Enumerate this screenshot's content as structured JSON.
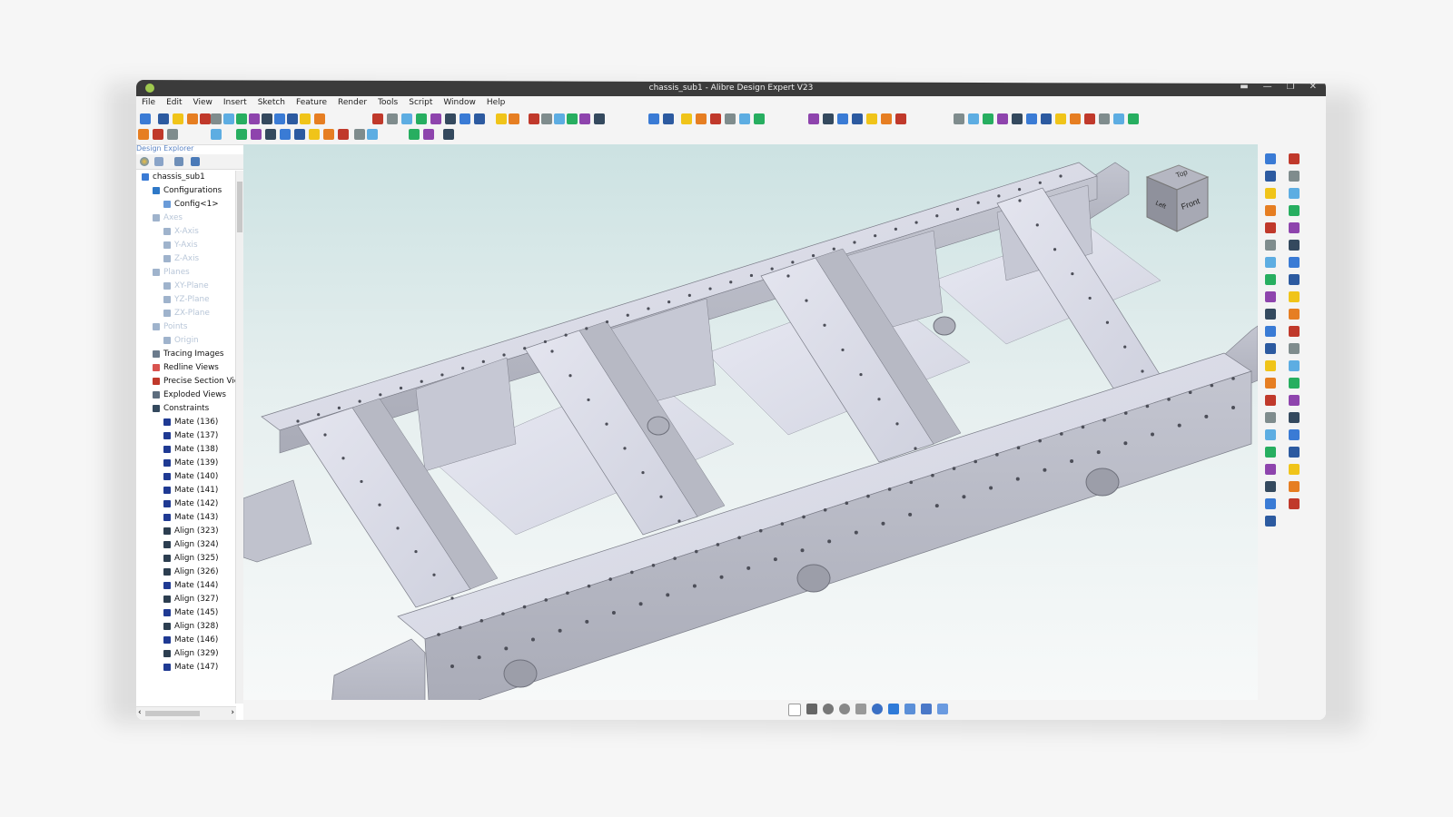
{
  "window": {
    "title": "chassis_sub1 - Alibre Design Expert V23"
  },
  "menu": [
    "File",
    "Edit",
    "View",
    "Insert",
    "Sketch",
    "Feature",
    "Render",
    "Tools",
    "Script",
    "Window",
    "Help"
  ],
  "explorer": {
    "label": "Design Explorer",
    "tree": [
      {
        "label": "chassis_sub1",
        "indent": 0,
        "dim": false,
        "icon": "assembly-icon",
        "color": "#3a7bd5"
      },
      {
        "label": "Configurations",
        "indent": 1,
        "dim": false,
        "icon": "configurations-icon",
        "color": "#2e78c7"
      },
      {
        "label": "Config<1>",
        "indent": 2,
        "dim": false,
        "icon": "config-icon",
        "color": "#6a9bd8"
      },
      {
        "label": "Axes",
        "indent": 1,
        "dim": true,
        "icon": "axes-icon",
        "color": "#9fb3cc"
      },
      {
        "label": "X-Axis",
        "indent": 2,
        "dim": true,
        "icon": "axis-icon",
        "color": "#9fb3cc"
      },
      {
        "label": "Y-Axis",
        "indent": 2,
        "dim": true,
        "icon": "axis-icon",
        "color": "#9fb3cc"
      },
      {
        "label": "Z-Axis",
        "indent": 2,
        "dim": true,
        "icon": "axis-icon",
        "color": "#9fb3cc"
      },
      {
        "label": "Planes",
        "indent": 1,
        "dim": true,
        "icon": "planes-icon",
        "color": "#9fb3cc"
      },
      {
        "label": "XY-Plane",
        "indent": 2,
        "dim": true,
        "icon": "plane-icon",
        "color": "#9fb3cc"
      },
      {
        "label": "YZ-Plane",
        "indent": 2,
        "dim": true,
        "icon": "plane-icon",
        "color": "#9fb3cc"
      },
      {
        "label": "ZX-Plane",
        "indent": 2,
        "dim": true,
        "icon": "plane-icon",
        "color": "#9fb3cc"
      },
      {
        "label": "Points",
        "indent": 1,
        "dim": true,
        "icon": "points-icon",
        "color": "#9fb3cc"
      },
      {
        "label": "Origin",
        "indent": 2,
        "dim": true,
        "icon": "origin-icon",
        "color": "#9fb3cc"
      },
      {
        "label": "Tracing Images",
        "indent": 1,
        "dim": false,
        "icon": "image-icon",
        "color": "#6b7b8c"
      },
      {
        "label": "Redline Views",
        "indent": 1,
        "dim": false,
        "icon": "redline-icon",
        "color": "#d9534f"
      },
      {
        "label": "Precise Section View",
        "indent": 1,
        "dim": false,
        "icon": "section-icon",
        "color": "#c0392b"
      },
      {
        "label": "Exploded Views",
        "indent": 1,
        "dim": false,
        "icon": "exploded-icon",
        "color": "#5d6d7e"
      },
      {
        "label": "Constraints",
        "indent": 1,
        "dim": false,
        "icon": "constraints-icon",
        "color": "#34495e"
      },
      {
        "label": "Mate (136)",
        "indent": 2,
        "dim": false,
        "icon": "mate-icon",
        "color": "#1f3a93"
      },
      {
        "label": "Mate (137)",
        "indent": 2,
        "dim": false,
        "icon": "mate-icon",
        "color": "#1f3a93"
      },
      {
        "label": "Mate (138)",
        "indent": 2,
        "dim": false,
        "icon": "mate-icon",
        "color": "#1f3a93"
      },
      {
        "label": "Mate (139)",
        "indent": 2,
        "dim": false,
        "icon": "mate-icon",
        "color": "#1f3a93"
      },
      {
        "label": "Mate (140)",
        "indent": 2,
        "dim": false,
        "icon": "mate-icon",
        "color": "#1f3a93"
      },
      {
        "label": "Mate (141)",
        "indent": 2,
        "dim": false,
        "icon": "mate-icon",
        "color": "#1f3a93"
      },
      {
        "label": "Mate (142)",
        "indent": 2,
        "dim": false,
        "icon": "mate-icon",
        "color": "#1f3a93"
      },
      {
        "label": "Mate (143)",
        "indent": 2,
        "dim": false,
        "icon": "mate-icon",
        "color": "#1f3a93"
      },
      {
        "label": "Align (323)",
        "indent": 2,
        "dim": false,
        "icon": "align-icon",
        "color": "#2c3e50"
      },
      {
        "label": "Align (324)",
        "indent": 2,
        "dim": false,
        "icon": "align-icon",
        "color": "#2c3e50"
      },
      {
        "label": "Align (325)",
        "indent": 2,
        "dim": false,
        "icon": "align-icon",
        "color": "#2c3e50"
      },
      {
        "label": "Align (326)",
        "indent": 2,
        "dim": false,
        "icon": "align-icon",
        "color": "#2c3e50"
      },
      {
        "label": "Mate (144)",
        "indent": 2,
        "dim": false,
        "icon": "mate-icon",
        "color": "#1f3a93"
      },
      {
        "label": "Align (327)",
        "indent": 2,
        "dim": false,
        "icon": "align-icon",
        "color": "#2c3e50"
      },
      {
        "label": "Mate (145)",
        "indent": 2,
        "dim": false,
        "icon": "mate-icon",
        "color": "#1f3a93"
      },
      {
        "label": "Align (328)",
        "indent": 2,
        "dim": false,
        "icon": "align-icon",
        "color": "#2c3e50"
      },
      {
        "label": "Mate (146)",
        "indent": 2,
        "dim": false,
        "icon": "mate-icon",
        "color": "#1f3a93"
      },
      {
        "label": "Align (329)",
        "indent": 2,
        "dim": false,
        "icon": "align-icon",
        "color": "#2c3e50"
      },
      {
        "label": "Mate (147)",
        "indent": 2,
        "dim": false,
        "icon": "mate-icon",
        "color": "#1f3a93"
      }
    ]
  },
  "viewcube": {
    "top": "Top",
    "left": "Left",
    "front": "Front"
  },
  "colors": {
    "accent": "#3a7bd5",
    "titlebar": "#3b3b3b",
    "chassis_top": "#d9dbe8",
    "chassis_side": "#b9bbc6",
    "chassis_dark": "#8f919c"
  }
}
